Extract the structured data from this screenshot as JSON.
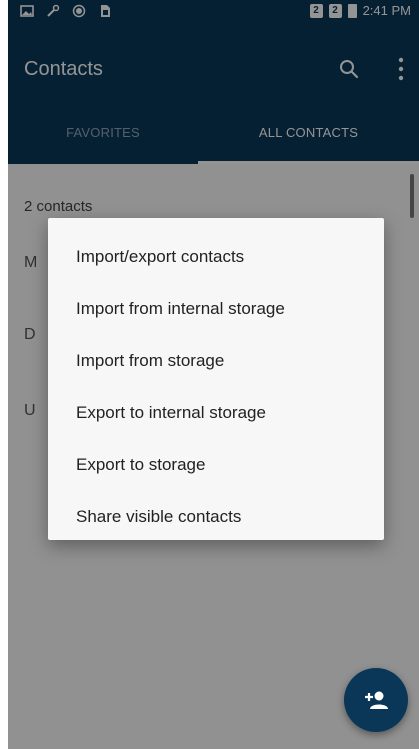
{
  "status_bar": {
    "time": "2:41 PM",
    "left_icons": [
      "image-icon",
      "wrench-icon",
      "record-icon",
      "sim-icon"
    ],
    "right_icons": [
      "sim-1-icon",
      "sim-2-icon",
      "battery-icon"
    ]
  },
  "app_bar": {
    "title": "Contacts",
    "actions": [
      "search-icon",
      "overflow-menu-icon"
    ]
  },
  "tabs": [
    {
      "label": "FAVORITES",
      "selected": false
    },
    {
      "label": "ALL CONTACTS",
      "selected": true
    }
  ],
  "contacts": {
    "count_label": "2 contacts",
    "rows": [
      "M",
      "D",
      "U"
    ]
  },
  "menu": {
    "items": [
      "Import/export contacts",
      "Import from internal storage",
      "Import from storage",
      "Export to internal storage",
      "Export to storage",
      "Share visible contacts"
    ]
  },
  "fab": {
    "icon": "add-contact-icon"
  },
  "colors": {
    "primary": "#0a3758",
    "menu_background": "#f7f7f7",
    "scrim": "rgba(0,0,0,0.42)"
  }
}
